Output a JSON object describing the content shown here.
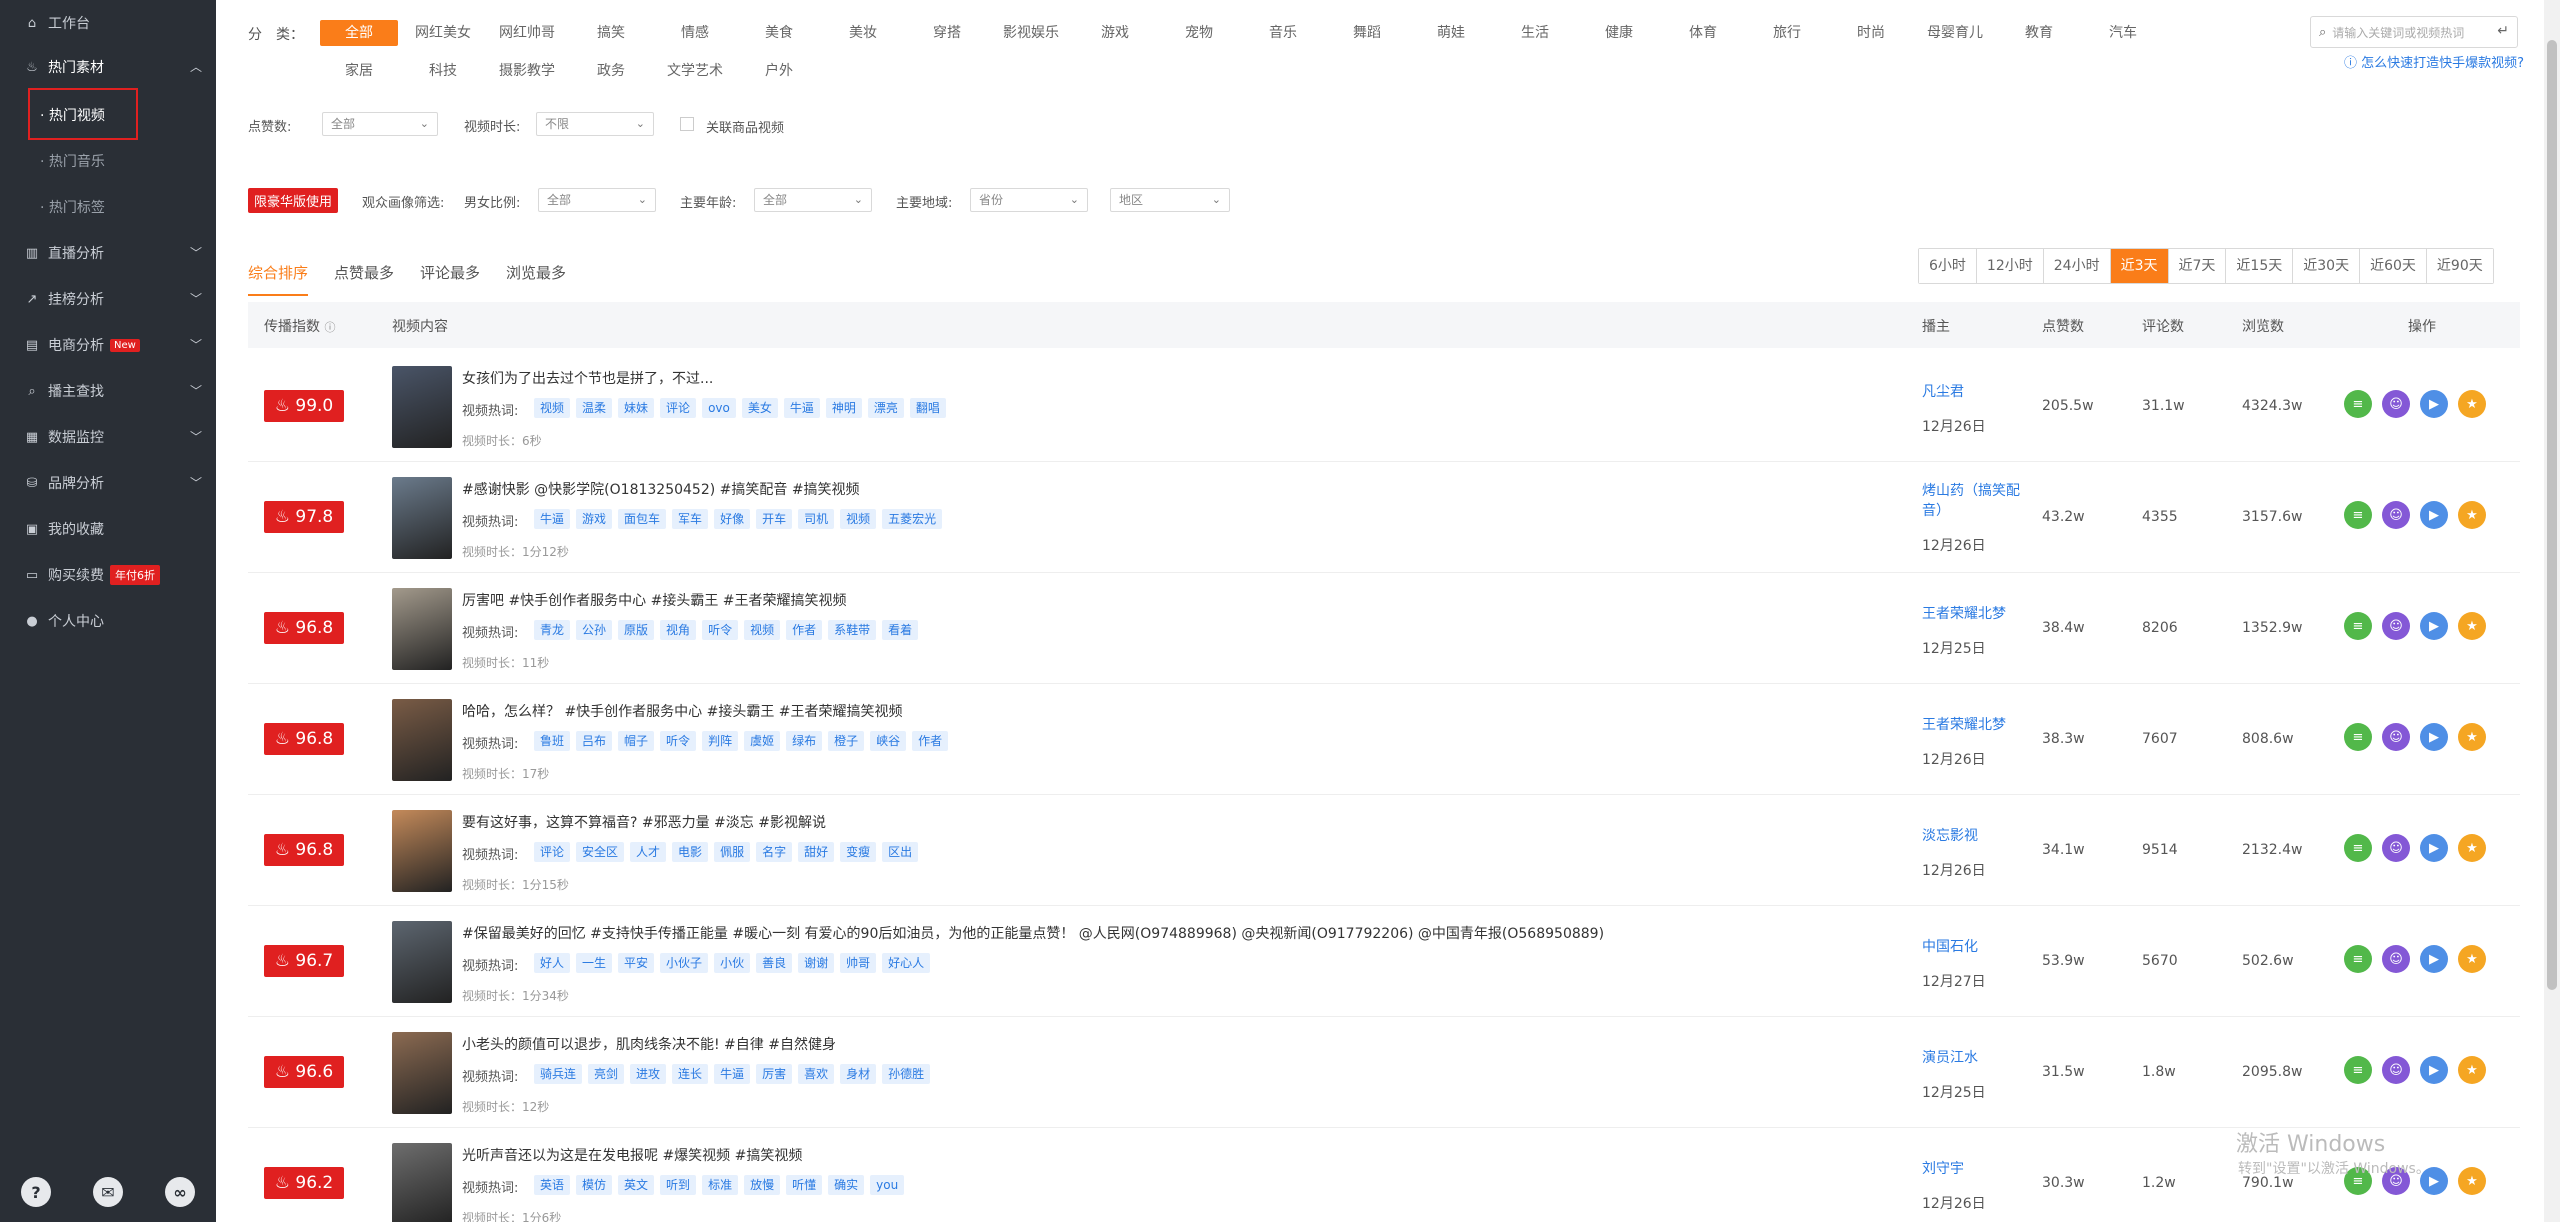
{
  "sidebar": {
    "items": [
      {
        "label": "工作台",
        "icon": "home-icon"
      },
      {
        "label": "热门素材",
        "icon": "fire-icon"
      },
      {
        "label": "直播分析",
        "icon": "bar-chart-icon"
      },
      {
        "label": "挂榜分析",
        "icon": "line-chart-icon"
      },
      {
        "label": "电商分析",
        "icon": "cart-icon",
        "badge": "New"
      },
      {
        "label": "播主查找",
        "icon": "search-icon"
      },
      {
        "label": "数据监控",
        "icon": "monitor-icon"
      },
      {
        "label": "品牌分析",
        "icon": "brand-icon"
      },
      {
        "label": "我的收藏",
        "icon": "star-icon"
      },
      {
        "label": "购买续费",
        "icon": "wallet-icon",
        "badge": "年付6折"
      },
      {
        "label": "个人中心",
        "icon": "user-icon"
      }
    ],
    "subitems": [
      {
        "label": "· 热门视频"
      },
      {
        "label": "· 热门音乐"
      },
      {
        "label": "· 热门标签"
      }
    ],
    "footer": [
      "?",
      "chat",
      "link"
    ]
  },
  "filters": {
    "category_label": "分　类：",
    "categories_row1": [
      "全部",
      "网红美女",
      "网红帅哥",
      "搞笑",
      "情感",
      "美食",
      "美妆",
      "穿搭",
      "影视娱乐",
      "游戏",
      "宠物",
      "音乐",
      "舞蹈",
      "萌娃",
      "生活",
      "健康",
      "体育",
      "旅行",
      "时尚",
      "母婴育儿",
      "教育",
      "汽车"
    ],
    "categories_row2": [
      "家居",
      "科技",
      "摄影教学",
      "政务",
      "文学艺术",
      "户外"
    ],
    "search_placeholder": "请输入关键词或视频热词",
    "help_link": "怎么快速打造快手爆款视频?",
    "likes_label": "点赞数:",
    "likes_value": "全部",
    "duration_label": "视频时长:",
    "duration_value": "不限",
    "related_goods_label": "关联商品视频",
    "limit_badge": "限豪华版使用",
    "audience_label": "观众画像筛选:",
    "gender_label": "男女比例:",
    "gender_value": "全部",
    "age_label": "主要年龄:",
    "age_value": "全部",
    "region_label": "主要地域:",
    "province_value": "省份",
    "city_value": "地区"
  },
  "sort_tabs": [
    "综合排序",
    "点赞最多",
    "评论最多",
    "浏览最多"
  ],
  "time_ranges": [
    "6小时",
    "12小时",
    "24小时",
    "近3天",
    "近7天",
    "近15天",
    "近30天",
    "近60天",
    "近90天"
  ],
  "time_active": "近3天",
  "table": {
    "headers": [
      "传播指数",
      "视频内容",
      "播主",
      "点赞数",
      "评论数",
      "浏览数",
      "操作"
    ],
    "hot_label": "视频热词:",
    "rows": [
      {
        "score": "99.0",
        "title": "女孩们为了出去过个节也是拼了，不过...",
        "tags": [
          "视频",
          "温柔",
          "妹妹",
          "评论",
          "ovo",
          "美女",
          "牛逼",
          "神明",
          "漂亮",
          "翻唱"
        ],
        "duration": "视频时长：6秒",
        "creator": "凡尘君",
        "date": "12月26日",
        "likes": "205.5w",
        "comments": "31.1w",
        "views": "4324.3w",
        "thumb_color": "#4a5568"
      },
      {
        "score": "97.8",
        "title": "#感谢快影 @快影学院(O1813250452) #搞笑配音 #搞笑视频",
        "tags": [
          "牛逼",
          "游戏",
          "面包车",
          "军车",
          "好像",
          "开车",
          "司机",
          "视频",
          "五菱宏光"
        ],
        "duration": "视频时长：1分12秒",
        "creator": "烤山药（搞笑配音）",
        "date": "12月26日",
        "likes": "43.2w",
        "comments": "4355",
        "views": "3157.6w",
        "thumb_color": "#6b7b8c"
      },
      {
        "score": "96.8",
        "title": "厉害吧 #快手创作者服务中心 #接头霸王 #王者荣耀搞笑视频",
        "tags": [
          "青龙",
          "公孙",
          "原版",
          "视角",
          "听令",
          "视频",
          "作者",
          "系鞋带",
          "看着"
        ],
        "duration": "视频时长：11秒",
        "creator": "王者荣耀北梦",
        "date": "12月25日",
        "likes": "38.4w",
        "comments": "8206",
        "views": "1352.9w",
        "thumb_color": "#a39a8c"
      },
      {
        "score": "96.8",
        "title": "哈哈，怎么样？ #快手创作者服务中心 #接头霸王 #王者荣耀搞笑视频",
        "tags": [
          "鲁班",
          "吕布",
          "帽子",
          "听令",
          "判阵",
          "虞姬",
          "绿布",
          "橙子",
          "峡谷",
          "作者"
        ],
        "duration": "视频时长：17秒",
        "creator": "王者荣耀北梦",
        "date": "12月26日",
        "likes": "38.3w",
        "comments": "7607",
        "views": "808.6w",
        "thumb_color": "#7a5c46"
      },
      {
        "score": "96.8",
        "title": "要有这好事，这算不算福音? #邪恶力量 #淡忘 #影视解说",
        "tags": [
          "评论",
          "安全区",
          "人才",
          "电影",
          "佩服",
          "名字",
          "甜好",
          "变瘦",
          "区出"
        ],
        "duration": "视频时长：1分15秒",
        "creator": "淡忘影视",
        "date": "12月26日",
        "likes": "34.1w",
        "comments": "9514",
        "views": "2132.4w",
        "thumb_color": "#c48a5a"
      },
      {
        "score": "96.7",
        "title": "#保留最美好的回忆 #支持快手传播正能量 #暖心一刻 有爱心的90后如油员，为他的正能量点赞！ @人民网(O974889968) @央视新闻(O917792206) @中国青年报(O568950889)",
        "tags": [
          "好人",
          "一生",
          "平安",
          "小伙子",
          "小伙",
          "善良",
          "谢谢",
          "帅哥",
          "好心人"
        ],
        "duration": "视频时长：1分34秒",
        "creator": "中国石化",
        "date": "12月27日",
        "likes": "53.9w",
        "comments": "5670",
        "views": "502.6w",
        "thumb_color": "#5d6670"
      },
      {
        "score": "96.6",
        "title": "小老头的颜值可以退步，肌肉线条决不能! #自律 #自然健身",
        "tags": [
          "骑兵连",
          "亮剑",
          "进攻",
          "连长",
          "牛逼",
          "厉害",
          "喜欢",
          "身材",
          "孙德胜"
        ],
        "duration": "视频时长：12秒",
        "creator": "演员江水",
        "date": "12月25日",
        "likes": "31.5w",
        "comments": "1.8w",
        "views": "2095.8w",
        "thumb_color": "#8c6b52"
      },
      {
        "score": "96.2",
        "title": "光听声音还以为这是在发电报呢 #爆笑视频 #搞笑视频",
        "tags": [
          "英语",
          "模仿",
          "英文",
          "听到",
          "标准",
          "放慢",
          "听懂",
          "确实",
          "you"
        ],
        "duration": "视频时长：1分6秒",
        "creator": "刘守宇",
        "date": "12月26日",
        "likes": "30.3w",
        "comments": "1.2w",
        "views": "790.1w",
        "thumb_color": "#6e6e6e"
      }
    ]
  },
  "watermark": {
    "title": "激活 Windows",
    "sub": "转到\"设置\"以激活 Windows。"
  },
  "colors": {
    "accent": "#fa7d19",
    "sidebar": "#2a2f36",
    "score": "#e02020",
    "link": "#2a7ae2"
  }
}
